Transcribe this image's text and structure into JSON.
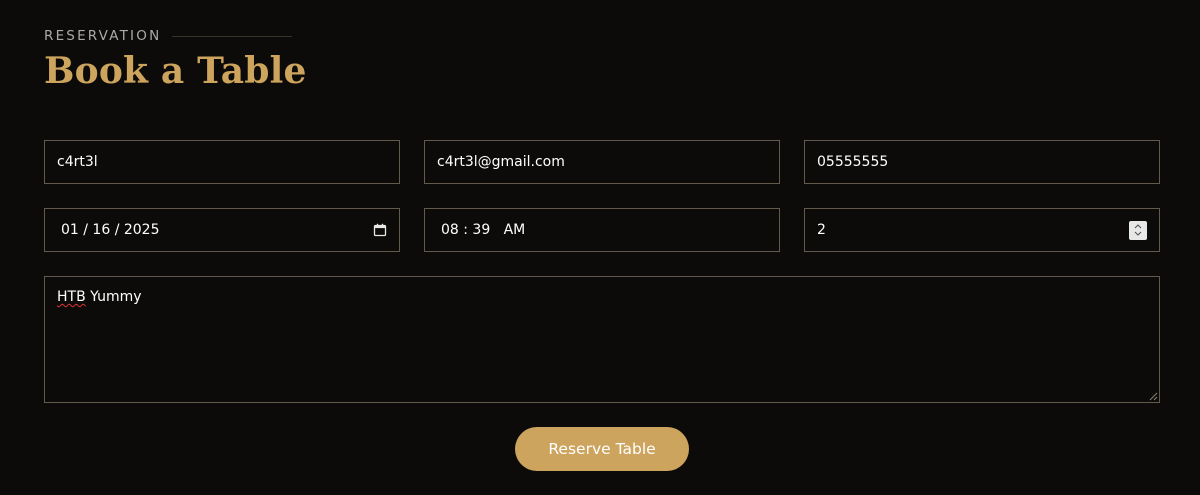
{
  "section": {
    "tag": "RESERVATION",
    "title": "Book a Table"
  },
  "form": {
    "name": "c4rt3l",
    "email": "c4rt3l@gmail.com",
    "phone": "05555555",
    "date": "01 / 16 / 2025",
    "time": "08 : 39   AM",
    "people": "2",
    "message_first_word": "HTB",
    "message_rest": " Yummy",
    "submit_label": "Reserve Table"
  },
  "icons": {
    "date": "calendar-icon",
    "people_stepper": "spinner-icon",
    "textarea": "resize-grip-icon"
  },
  "colors": {
    "accent": "#cda45e",
    "background": "#0c0b09",
    "border": "#625b4b",
    "spellcheck": "#e0322f"
  }
}
